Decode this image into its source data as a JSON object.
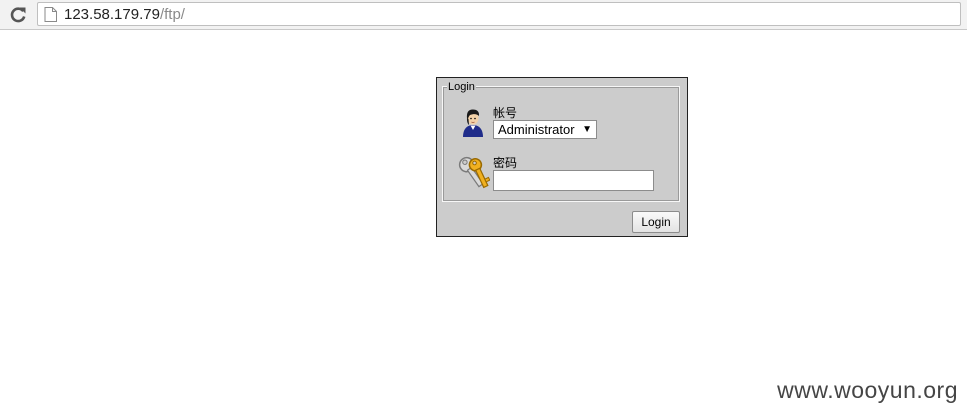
{
  "browser": {
    "url_host": "123.58.179.79",
    "url_path": "/ftp/",
    "icons": {
      "reload": "reload-icon",
      "page": "page-icon"
    }
  },
  "login": {
    "legend": "Login",
    "account_label": "帐号",
    "account_selected": "Administrator",
    "password_label": "密码",
    "password_value": "",
    "button_label": "Login",
    "icons": {
      "user": "user-icon",
      "key": "key-icon"
    }
  },
  "watermark": "www.wooyun.org"
}
